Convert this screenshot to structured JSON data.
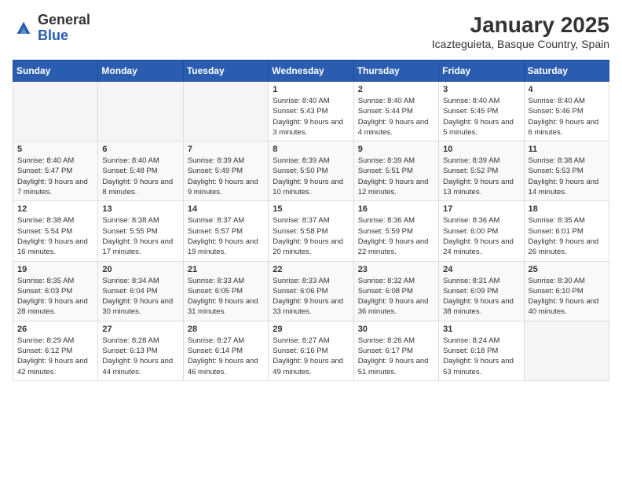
{
  "header": {
    "logo_general": "General",
    "logo_blue": "Blue",
    "title": "January 2025",
    "subtitle": "Icazteguieta, Basque Country, Spain"
  },
  "calendar": {
    "days_of_week": [
      "Sunday",
      "Monday",
      "Tuesday",
      "Wednesday",
      "Thursday",
      "Friday",
      "Saturday"
    ],
    "weeks": [
      [
        {
          "day": "",
          "info": ""
        },
        {
          "day": "",
          "info": ""
        },
        {
          "day": "",
          "info": ""
        },
        {
          "day": "1",
          "info": "Sunrise: 8:40 AM\nSunset: 5:43 PM\nDaylight: 9 hours and 3 minutes."
        },
        {
          "day": "2",
          "info": "Sunrise: 8:40 AM\nSunset: 5:44 PM\nDaylight: 9 hours and 4 minutes."
        },
        {
          "day": "3",
          "info": "Sunrise: 8:40 AM\nSunset: 5:45 PM\nDaylight: 9 hours and 5 minutes."
        },
        {
          "day": "4",
          "info": "Sunrise: 8:40 AM\nSunset: 5:46 PM\nDaylight: 9 hours and 6 minutes."
        }
      ],
      [
        {
          "day": "5",
          "info": "Sunrise: 8:40 AM\nSunset: 5:47 PM\nDaylight: 9 hours and 7 minutes."
        },
        {
          "day": "6",
          "info": "Sunrise: 8:40 AM\nSunset: 5:48 PM\nDaylight: 9 hours and 8 minutes."
        },
        {
          "day": "7",
          "info": "Sunrise: 8:39 AM\nSunset: 5:49 PM\nDaylight: 9 hours and 9 minutes."
        },
        {
          "day": "8",
          "info": "Sunrise: 8:39 AM\nSunset: 5:50 PM\nDaylight: 9 hours and 10 minutes."
        },
        {
          "day": "9",
          "info": "Sunrise: 8:39 AM\nSunset: 5:51 PM\nDaylight: 9 hours and 12 minutes."
        },
        {
          "day": "10",
          "info": "Sunrise: 8:39 AM\nSunset: 5:52 PM\nDaylight: 9 hours and 13 minutes."
        },
        {
          "day": "11",
          "info": "Sunrise: 8:38 AM\nSunset: 5:53 PM\nDaylight: 9 hours and 14 minutes."
        }
      ],
      [
        {
          "day": "12",
          "info": "Sunrise: 8:38 AM\nSunset: 5:54 PM\nDaylight: 9 hours and 16 minutes."
        },
        {
          "day": "13",
          "info": "Sunrise: 8:38 AM\nSunset: 5:55 PM\nDaylight: 9 hours and 17 minutes."
        },
        {
          "day": "14",
          "info": "Sunrise: 8:37 AM\nSunset: 5:57 PM\nDaylight: 9 hours and 19 minutes."
        },
        {
          "day": "15",
          "info": "Sunrise: 8:37 AM\nSunset: 5:58 PM\nDaylight: 9 hours and 20 minutes."
        },
        {
          "day": "16",
          "info": "Sunrise: 8:36 AM\nSunset: 5:59 PM\nDaylight: 9 hours and 22 minutes."
        },
        {
          "day": "17",
          "info": "Sunrise: 8:36 AM\nSunset: 6:00 PM\nDaylight: 9 hours and 24 minutes."
        },
        {
          "day": "18",
          "info": "Sunrise: 8:35 AM\nSunset: 6:01 PM\nDaylight: 9 hours and 26 minutes."
        }
      ],
      [
        {
          "day": "19",
          "info": "Sunrise: 8:35 AM\nSunset: 6:03 PM\nDaylight: 9 hours and 28 minutes."
        },
        {
          "day": "20",
          "info": "Sunrise: 8:34 AM\nSunset: 6:04 PM\nDaylight: 9 hours and 30 minutes."
        },
        {
          "day": "21",
          "info": "Sunrise: 8:33 AM\nSunset: 6:05 PM\nDaylight: 9 hours and 31 minutes."
        },
        {
          "day": "22",
          "info": "Sunrise: 8:33 AM\nSunset: 6:06 PM\nDaylight: 9 hours and 33 minutes."
        },
        {
          "day": "23",
          "info": "Sunrise: 8:32 AM\nSunset: 6:08 PM\nDaylight: 9 hours and 36 minutes."
        },
        {
          "day": "24",
          "info": "Sunrise: 8:31 AM\nSunset: 6:09 PM\nDaylight: 9 hours and 38 minutes."
        },
        {
          "day": "25",
          "info": "Sunrise: 8:30 AM\nSunset: 6:10 PM\nDaylight: 9 hours and 40 minutes."
        }
      ],
      [
        {
          "day": "26",
          "info": "Sunrise: 8:29 AM\nSunset: 6:12 PM\nDaylight: 9 hours and 42 minutes."
        },
        {
          "day": "27",
          "info": "Sunrise: 8:28 AM\nSunset: 6:13 PM\nDaylight: 9 hours and 44 minutes."
        },
        {
          "day": "28",
          "info": "Sunrise: 8:27 AM\nSunset: 6:14 PM\nDaylight: 9 hours and 46 minutes."
        },
        {
          "day": "29",
          "info": "Sunrise: 8:27 AM\nSunset: 6:16 PM\nDaylight: 9 hours and 49 minutes."
        },
        {
          "day": "30",
          "info": "Sunrise: 8:26 AM\nSunset: 6:17 PM\nDaylight: 9 hours and 51 minutes."
        },
        {
          "day": "31",
          "info": "Sunrise: 8:24 AM\nSunset: 6:18 PM\nDaylight: 9 hours and 53 minutes."
        },
        {
          "day": "",
          "info": ""
        }
      ]
    ]
  }
}
